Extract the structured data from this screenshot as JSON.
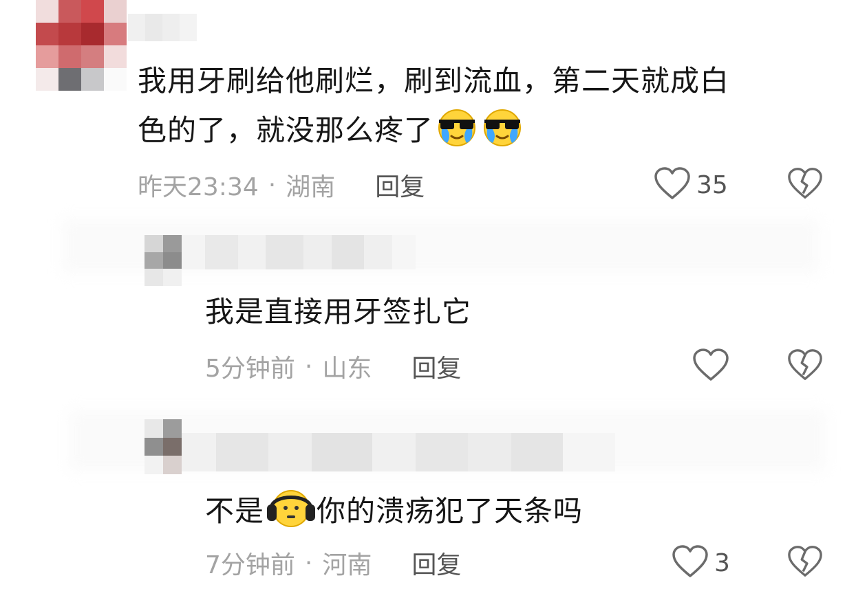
{
  "comments": [
    {
      "text_line1": "我用牙刷给他刷烂，刷到流血，第二天就成白",
      "text_line2": "色的了，就没那么疼了",
      "emoji": [
        "sunglasses-crying-icon",
        "sunglasses-crying-icon"
      ],
      "time": "昨天23:34",
      "separator": "·",
      "location": "湖南",
      "reply_label": "回复",
      "like_count": "35"
    },
    {
      "text": "我是直接用牙签扎它",
      "time": "5分钟前",
      "separator": "·",
      "location": "山东",
      "reply_label": "回复",
      "like_count": ""
    },
    {
      "text_before": "不是",
      "emoji": "headphones-face-icon",
      "text_after": "你的溃疡犯了天条吗",
      "time": "7分钟前",
      "separator": "·",
      "location": "河南",
      "reply_label": "回复",
      "like_count": "3"
    }
  ],
  "colors": {
    "text": "#161616",
    "meta": "#a3a3a3",
    "icon": "#6b6b6b"
  }
}
